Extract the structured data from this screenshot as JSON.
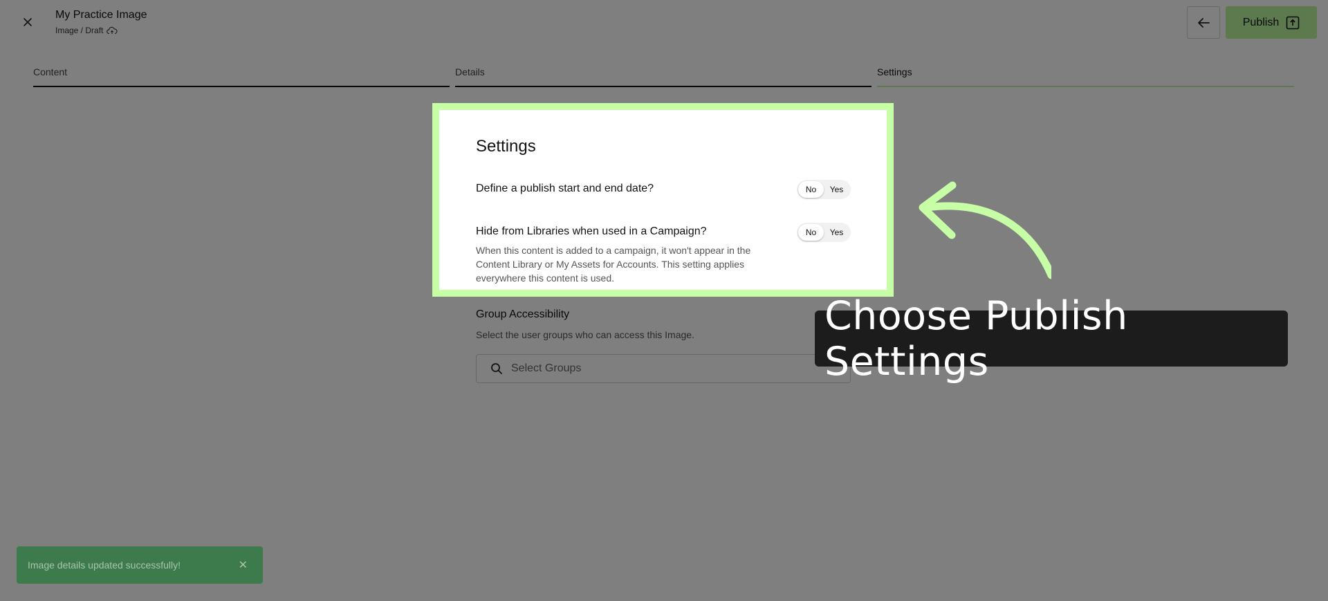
{
  "header": {
    "title": "My Practice Image",
    "breadcrumb": "Image / Draft",
    "publish_label": "Publish"
  },
  "tabs": [
    {
      "label": "Content"
    },
    {
      "label": "Details"
    },
    {
      "label": "Settings",
      "active": true
    }
  ],
  "settings": {
    "heading": "Settings",
    "publish_dates": {
      "question": "Define a publish start and end date?",
      "no_label": "No",
      "yes_label": "Yes",
      "selected": "No"
    },
    "hide_libraries": {
      "question": "Hide from Libraries when used in a Campaign?",
      "description": "When this content is added to a campaign, it won't appear in the Content Library or My Assets for Accounts. This setting applies everywhere this content is used.",
      "no_label": "No",
      "yes_label": "Yes",
      "selected": "No"
    },
    "group_accessibility": {
      "title": "Group Accessibility",
      "description": "Select the user groups who can access this Image.",
      "placeholder": "Select Groups"
    }
  },
  "overlay": {
    "callout_text": "Choose Publish Settings",
    "highlight_color": "#c6ffa5"
  },
  "toast": {
    "message": "Image details updated successfully!"
  },
  "colors": {
    "accent": "#b9f59b",
    "toast_bg": "#3d7a4c"
  }
}
